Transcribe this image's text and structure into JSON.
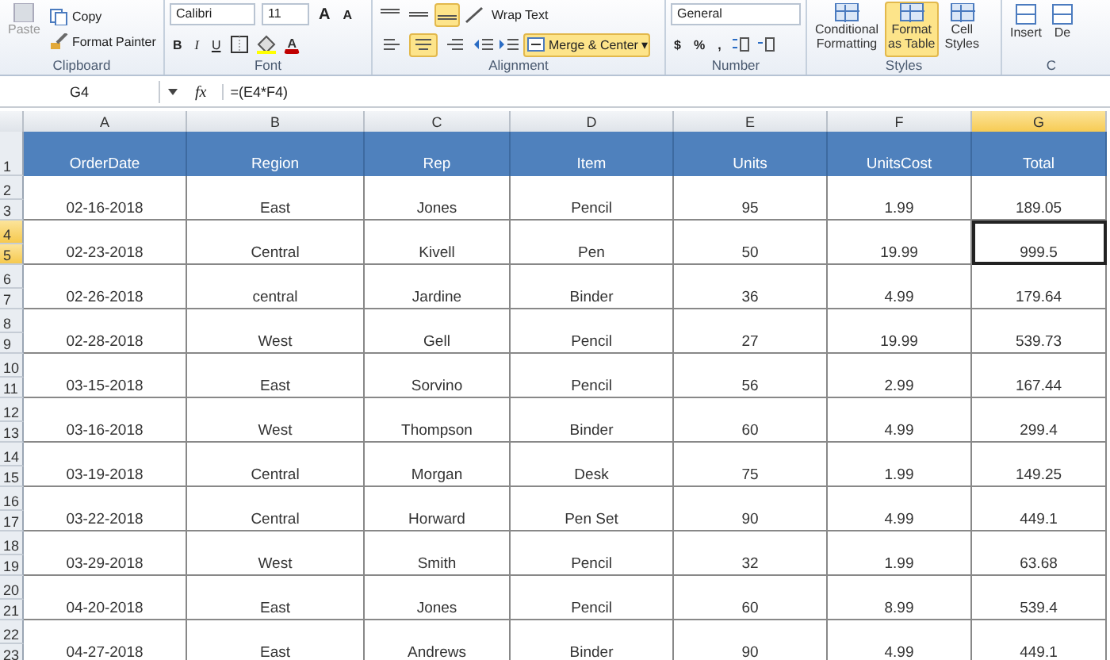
{
  "ribbon": {
    "clipboard": {
      "paste": "Paste",
      "copy": "Copy",
      "format_painter": "Format Painter",
      "label": "Clipboard"
    },
    "font": {
      "family": "Calibri",
      "size": "11",
      "grow": "A",
      "shrink": "A",
      "styles": [
        "B",
        "I",
        "U"
      ],
      "color_letter": "A",
      "label": "Font"
    },
    "alignment": {
      "vertical": [
        {
          "selected": false
        },
        {
          "selected": false
        },
        {
          "selected": true
        }
      ],
      "horizontal": [
        {
          "selected": false
        },
        {
          "selected": true
        },
        {
          "selected": false
        }
      ],
      "wrap_text": "Wrap Text",
      "merge": {
        "label": "Merge & Center",
        "caret": "▾",
        "selected": true
      },
      "label": "Alignment"
    },
    "number": {
      "format": "General",
      "symbols": [
        "$",
        "%",
        ","
      ],
      "label": "Number"
    },
    "styles": {
      "buttons": [
        {
          "lines": [
            "Conditional",
            "Formatting"
          ],
          "selected": false
        },
        {
          "lines": [
            "Format",
            "as Table"
          ],
          "selected": true
        },
        {
          "lines": [
            "Cell",
            "Styles"
          ],
          "selected": false
        }
      ],
      "label": "Styles"
    },
    "cells": {
      "buttons": [
        "Insert",
        "De"
      ],
      "label": "C"
    }
  },
  "formula_bar": {
    "name_box": "G4",
    "fx": "fx",
    "formula": "=(E4*F4)"
  },
  "sheet": {
    "header_row_number": "1",
    "columns": [
      {
        "letter": "A",
        "heading": "OrderDate",
        "selected": false
      },
      {
        "letter": "B",
        "heading": "Region",
        "selected": false
      },
      {
        "letter": "C",
        "heading": "Rep",
        "selected": false
      },
      {
        "letter": "D",
        "heading": "Item",
        "selected": false
      },
      {
        "letter": "E",
        "heading": "Units",
        "selected": false
      },
      {
        "letter": "F",
        "heading": "UnitsCost",
        "selected": false
      },
      {
        "letter": "G",
        "heading": "Total",
        "selected": true
      }
    ],
    "rows": [
      {
        "row_numbers": [
          "2",
          "3"
        ],
        "selected": false,
        "cells": [
          "02-16-2018",
          "East",
          "Jones",
          "Pencil",
          "95",
          "1.99",
          "189.05"
        ]
      },
      {
        "row_numbers": [
          "4",
          "5"
        ],
        "selected": true,
        "cells": [
          "02-23-2018",
          "Central",
          "Kivell",
          "Pen",
          "50",
          "19.99",
          "999.5"
        ]
      },
      {
        "row_numbers": [
          "6",
          "7"
        ],
        "selected": false,
        "cells": [
          "02-26-2018",
          "central",
          "Jardine",
          "Binder",
          "36",
          "4.99",
          "179.64"
        ]
      },
      {
        "row_numbers": [
          "8",
          "9"
        ],
        "selected": false,
        "cells": [
          "02-28-2018",
          "West",
          "Gell",
          "Pencil",
          "27",
          "19.99",
          "539.73"
        ]
      },
      {
        "row_numbers": [
          "10",
          "11"
        ],
        "selected": false,
        "cells": [
          "03-15-2018",
          "East",
          "Sorvino",
          "Pencil",
          "56",
          "2.99",
          "167.44"
        ]
      },
      {
        "row_numbers": [
          "12",
          "13"
        ],
        "selected": false,
        "cells": [
          "03-16-2018",
          "West",
          "Thompson",
          "Binder",
          "60",
          "4.99",
          "299.4"
        ]
      },
      {
        "row_numbers": [
          "14",
          "15"
        ],
        "selected": false,
        "cells": [
          "03-19-2018",
          "Central",
          "Morgan",
          "Desk",
          "75",
          "1.99",
          "149.25"
        ]
      },
      {
        "row_numbers": [
          "16",
          "17"
        ],
        "selected": false,
        "cells": [
          "03-22-2018",
          "Central",
          "Horward",
          "Pen Set",
          "90",
          "4.99",
          "449.1"
        ]
      },
      {
        "row_numbers": [
          "18",
          "19"
        ],
        "selected": false,
        "cells": [
          "03-29-2018",
          "West",
          "Smith",
          "Pencil",
          "32",
          "1.99",
          "63.68"
        ]
      },
      {
        "row_numbers": [
          "20",
          "21"
        ],
        "selected": false,
        "cells": [
          "04-20-2018",
          "East",
          "Jones",
          "Pencil",
          "60",
          "8.99",
          "539.4"
        ]
      },
      {
        "row_numbers": [
          "22",
          "23"
        ],
        "selected": false,
        "cells": [
          "04-27-2018",
          "East",
          "Andrews",
          "Binder",
          "90",
          "4.99",
          "449.1"
        ]
      }
    ]
  }
}
